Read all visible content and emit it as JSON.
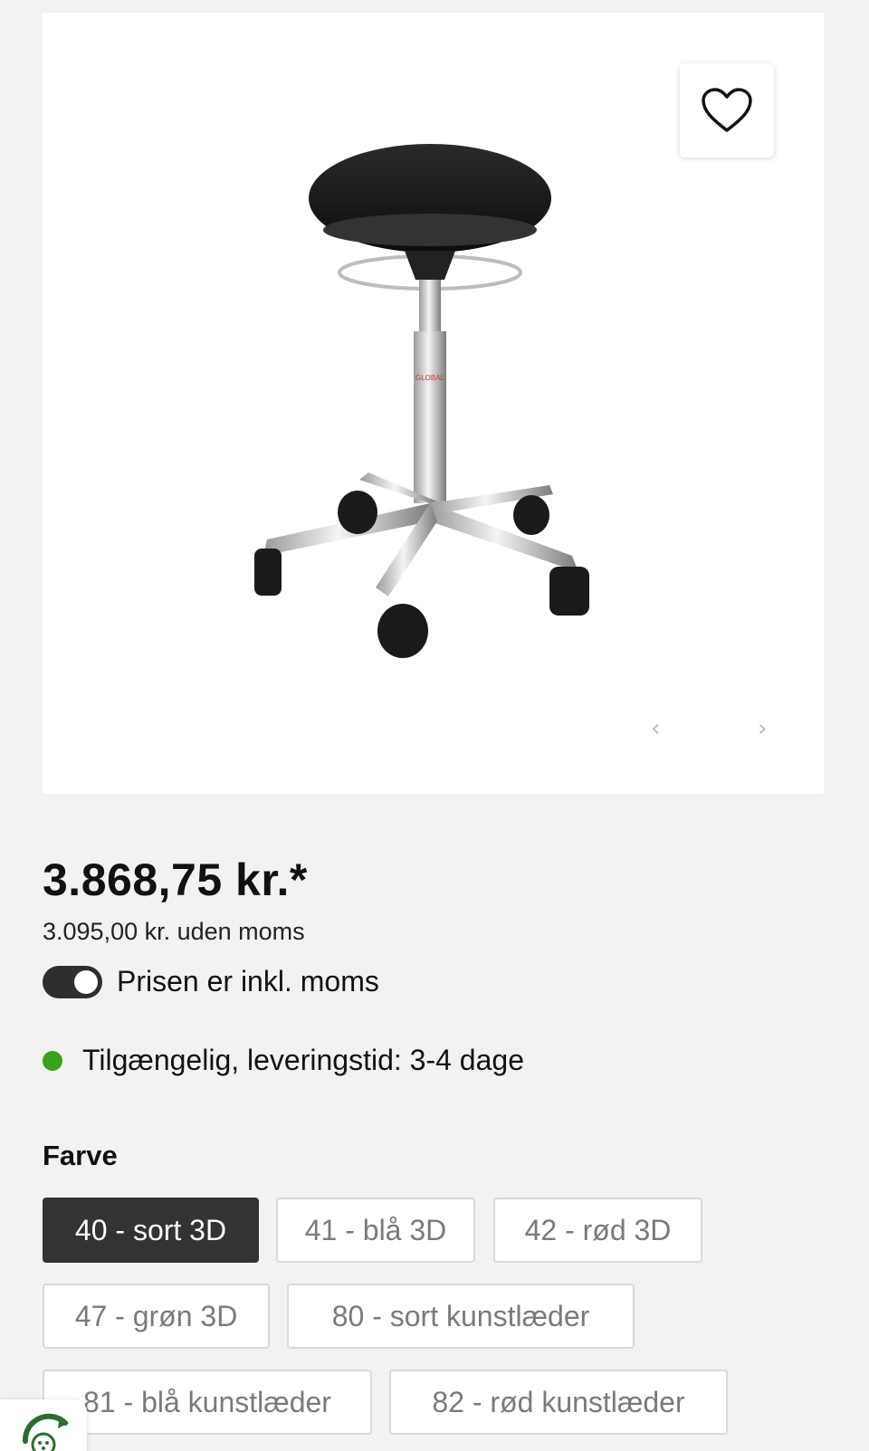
{
  "product": {
    "image_alt": "",
    "image_logo_text": "GLOBAL"
  },
  "carousel": {
    "prev_glyph": "‹",
    "next_glyph": "›"
  },
  "pricing": {
    "price": "3.868,75 kr.*",
    "price_ex_vat": "3.095,00 kr. uden moms",
    "vat_toggle_label": "Prisen er inkl. moms",
    "vat_toggle_on": true
  },
  "stock": {
    "text": "Tilgængelig, leveringstid: 3-4 dage",
    "status_color": "#3aa11a"
  },
  "color_options": {
    "heading": "Farve",
    "options": [
      {
        "label": "40 - sort 3D",
        "selected": true
      },
      {
        "label": "41 - blå 3D",
        "selected": false
      },
      {
        "label": "42 - rød 3D",
        "selected": false
      },
      {
        "label": "47 - grøn 3D",
        "selected": false
      },
      {
        "label": "80 - sort kunstlæder",
        "selected": false
      },
      {
        "label": "81 - blå kunstlæder",
        "selected": false
      },
      {
        "label": "82 - rød kunstlæder",
        "selected": false
      }
    ]
  },
  "icons": {
    "wishlist": "heart-icon",
    "chat": "chat-widget-icon"
  },
  "colors": {
    "selected_option_bg": "#333333",
    "page_bg": "#f2f2f2"
  }
}
